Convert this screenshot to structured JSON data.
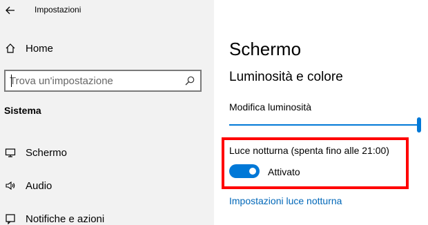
{
  "window": {
    "title": "Impostazioni",
    "back_icon": "back-arrow-icon"
  },
  "sidebar": {
    "home": {
      "label": "Home",
      "icon": "home-icon"
    },
    "search": {
      "placeholder": "Trova un'impostazione",
      "icon": "search-icon"
    },
    "section": "Sistema",
    "items": [
      {
        "label": "Schermo",
        "icon": "display-icon"
      },
      {
        "label": "Audio",
        "icon": "speaker-icon"
      },
      {
        "label": "Notifiche e azioni",
        "icon": "notification-icon"
      }
    ]
  },
  "main": {
    "page_title": "Schermo",
    "group_title": "Luminosità e colore",
    "brightness": {
      "label": "Modifica luminosità",
      "value_percent": 100
    },
    "night_light": {
      "status": "Luce notturna (spenta fino alle 21:00)",
      "toggle_label": "Attivato",
      "toggle_on": true,
      "settings_link": "Impostazioni luce notturna"
    }
  },
  "annotation": {
    "highlight_color": "#ff0000"
  },
  "colors": {
    "accent": "#0078d7",
    "link": "#0067b8",
    "sidebar_bg": "#f2f2f2"
  }
}
